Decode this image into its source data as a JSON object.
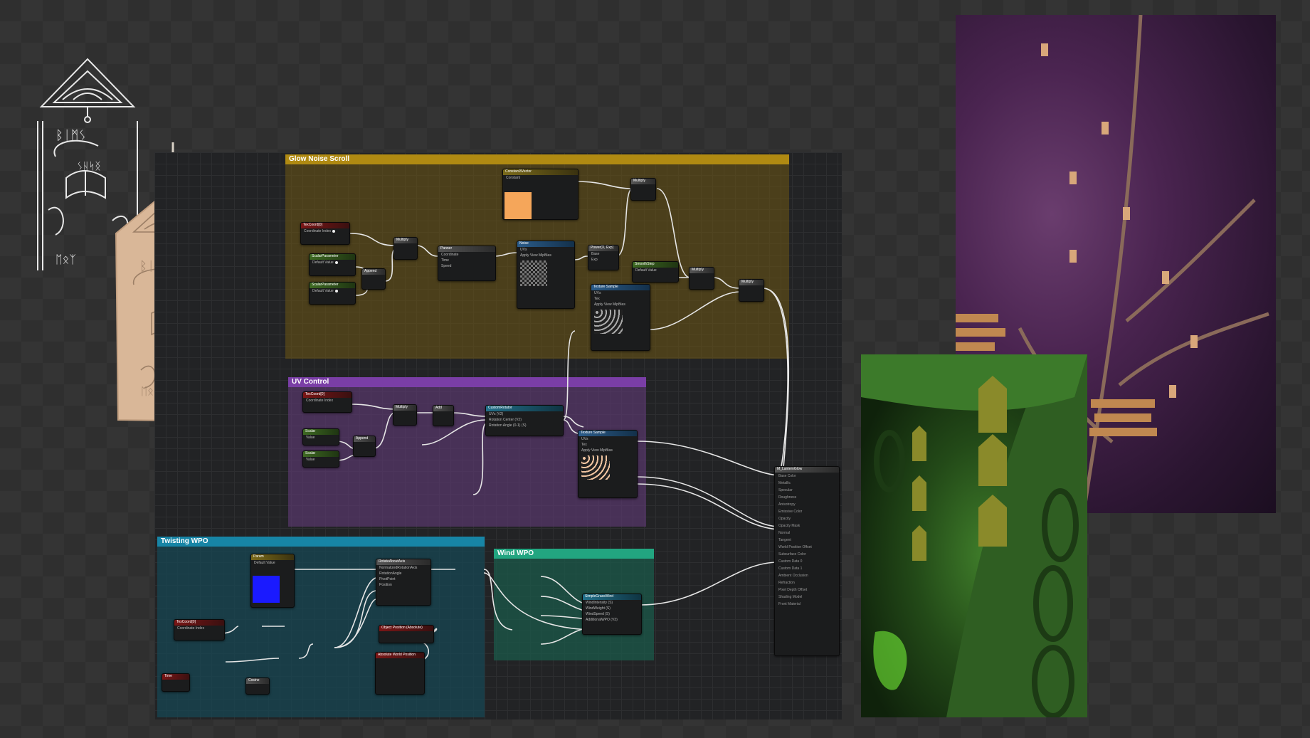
{
  "comments": {
    "glow": "Glow Noise Scroll",
    "uv": "UV Control",
    "twist": "Twisting WPO",
    "wind": "Wind WPO"
  },
  "colors": {
    "glow_swatch": "#f5a65a",
    "twist_swatch": "#1a1aff",
    "glow_comment": "#b08a12",
    "uv_comment": "#7a3ea6",
    "twist_comment": "#1785a6",
    "wind_comment": "#22a580"
  },
  "nodes": {
    "texcoord_a": {
      "title": "TexCoord[0]",
      "row": "Coordinate Index"
    },
    "scalar_a1": {
      "title": "ScalarParameter",
      "row": "Default Value"
    },
    "scalar_a2": {
      "title": "ScalarParameter",
      "row": "Default Value"
    },
    "append_a": {
      "title": "Append"
    },
    "multiply_a": {
      "title": "Multiply"
    },
    "panner_a": {
      "title": "Panner",
      "rows": [
        "Coordinate",
        "Time",
        "Speed"
      ]
    },
    "noise": {
      "title": "Noise",
      "rows": [
        "UVs",
        "Apply View MipBias"
      ]
    },
    "constant3": {
      "title": "Constant3Vector",
      "row": "Constant"
    },
    "power": {
      "title": "Power(X, Exp)",
      "rows": [
        "Base",
        "Exp"
      ]
    },
    "multiply_b": {
      "title": "Multiply"
    },
    "smoothstep": {
      "title": "SmoothStep",
      "row": "Default Value"
    },
    "multiply_c": {
      "title": "Multiply"
    },
    "multiply_d": {
      "title": "Multiply"
    },
    "tex_sample_a": {
      "title": "Texture Sample",
      "rows": [
        "UVs",
        "Tex",
        "Apply View MipBias"
      ]
    },
    "texcoord_b": {
      "title": "TexCoord[0]",
      "row": "Coordinate Index"
    },
    "scalar_b1": {
      "title": "Scalar",
      "row": "Value"
    },
    "scalar_b2": {
      "title": "Scalar",
      "row": "Value"
    },
    "append_b": {
      "title": "Append"
    },
    "multiply_e": {
      "title": "Multiply"
    },
    "add": {
      "title": "Add"
    },
    "custom_rotator": {
      "title": "CustomRotator",
      "rows": [
        "UVs (V2)",
        "Rotation Center (V2)",
        "Rotation Angle (0-1) (S)"
      ]
    },
    "tex_sample_b": {
      "title": "Texture Sample",
      "rows": [
        "UVs",
        "Tex",
        "Apply View MipBias"
      ]
    },
    "param_twist": {
      "title": "Param",
      "row": "Default Value"
    },
    "simple_grass_wind": {
      "title": "SimpleGrassWind",
      "rows": [
        "WindIntensity (S)",
        "WindWeight (S)",
        "WindSpeed (S)",
        "AdditionalWPO (V3)"
      ]
    },
    "rotate_about_axis": {
      "title": "RotateAboutAxis",
      "rows": [
        "NormalizedRotationAxis",
        "RotationAngle",
        "PivotPoint",
        "Position"
      ]
    },
    "object_position": {
      "title": "Object Position (Absolute)"
    },
    "absolute_world_position": {
      "title": "Absolute World Position"
    },
    "texcoord_c": {
      "title": "TexCoord[0]",
      "row": "Coordinate Index"
    },
    "time": {
      "title": "Time"
    },
    "cosine": {
      "title": "Cosine"
    },
    "mat_output": {
      "title": "M_LanternGlow",
      "pins": [
        "Base Color",
        "Metallic",
        "Specular",
        "Roughness",
        "Anisotropy",
        "Emissive Color",
        "Opacity",
        "Opacity Mask",
        "Normal",
        "Tangent",
        "World Position Offset",
        "Subsurface Color",
        "Custom Data 0",
        "Custom Data 1",
        "Ambient Occlusion",
        "Refraction",
        "Pixel Depth Offset",
        "Shading Model",
        "Front Material"
      ]
    }
  },
  "sketch": {
    "runes_top": "ᛒᛁᛗᛊ",
    "runes_mid": "ᛊᚺᛋᛝ",
    "runes_bot": "ᛖᛟᛉ"
  }
}
